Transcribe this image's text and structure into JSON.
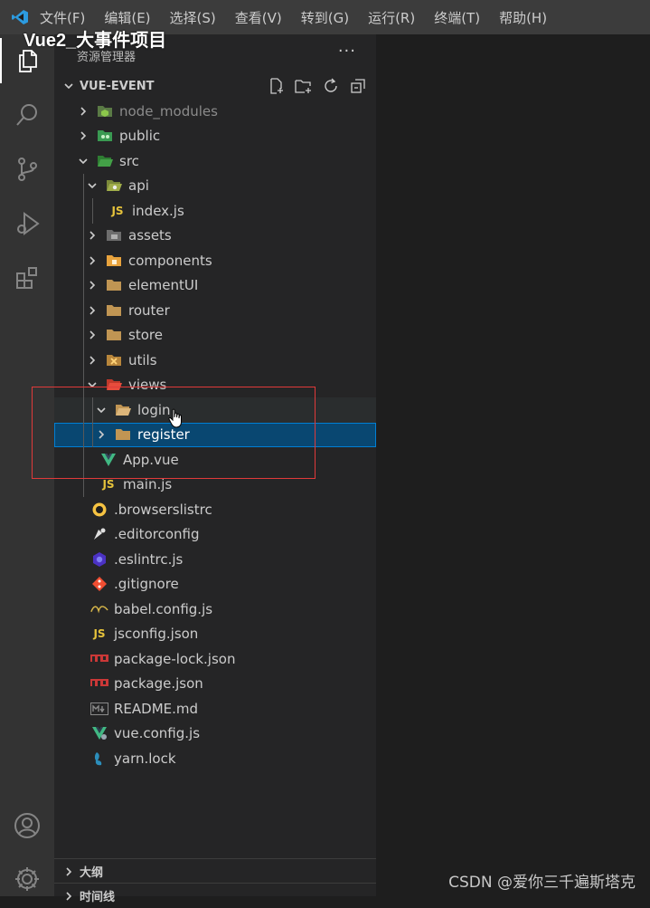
{
  "overlay_title": "Vue2_大事件项目",
  "menu": [
    "文件(F)",
    "编辑(E)",
    "选择(S)",
    "查看(V)",
    "转到(G)",
    "运行(R)",
    "终端(T)",
    "帮助(H)"
  ],
  "sidebar": {
    "title": "资源管理器",
    "more": "···",
    "project": "VUE-EVENT"
  },
  "tree": [
    {
      "label": "node_modules",
      "depth": 0,
      "kind": "folder",
      "expanded": false,
      "icon": "node-modules-icon",
      "dim": true
    },
    {
      "label": "public",
      "depth": 0,
      "kind": "folder",
      "expanded": false,
      "icon": "public-folder-icon"
    },
    {
      "label": "src",
      "depth": 0,
      "kind": "folder",
      "expanded": true,
      "icon": "src-folder-icon"
    },
    {
      "label": "api",
      "depth": 1,
      "kind": "folder",
      "expanded": true,
      "icon": "api-folder-icon"
    },
    {
      "label": "index.js",
      "depth": 2,
      "kind": "file",
      "icon": "js-icon"
    },
    {
      "label": "assets",
      "depth": 1,
      "kind": "folder",
      "expanded": false,
      "icon": "assets-folder-icon"
    },
    {
      "label": "components",
      "depth": 1,
      "kind": "folder",
      "expanded": false,
      "icon": "components-folder-icon"
    },
    {
      "label": "elementUI",
      "depth": 1,
      "kind": "folder",
      "expanded": false,
      "icon": "folder-icon"
    },
    {
      "label": "router",
      "depth": 1,
      "kind": "folder",
      "expanded": false,
      "icon": "folder-icon"
    },
    {
      "label": "store",
      "depth": 1,
      "kind": "folder",
      "expanded": false,
      "icon": "folder-icon"
    },
    {
      "label": "utils",
      "depth": 1,
      "kind": "folder",
      "expanded": false,
      "icon": "utils-folder-icon"
    },
    {
      "label": "views",
      "depth": 1,
      "kind": "folder",
      "expanded": true,
      "icon": "views-folder-icon"
    },
    {
      "label": "login",
      "depth": 2,
      "kind": "folder",
      "expanded": true,
      "icon": "open-folder-icon",
      "hover": true
    },
    {
      "label": "register",
      "depth": 2,
      "kind": "folder",
      "expanded": false,
      "icon": "folder-icon",
      "selected": true
    },
    {
      "label": "App.vue",
      "depth": 1,
      "kind": "file",
      "icon": "vue-icon"
    },
    {
      "label": "main.js",
      "depth": 1,
      "kind": "file",
      "icon": "js-icon"
    },
    {
      "label": ".browserslistrc",
      "depth": 0,
      "kind": "file",
      "icon": "browserslist-icon"
    },
    {
      "label": ".editorconfig",
      "depth": 0,
      "kind": "file",
      "icon": "editorconfig-icon"
    },
    {
      "label": ".eslintrc.js",
      "depth": 0,
      "kind": "file",
      "icon": "eslint-icon"
    },
    {
      "label": ".gitignore",
      "depth": 0,
      "kind": "file",
      "icon": "git-icon"
    },
    {
      "label": "babel.config.js",
      "depth": 0,
      "kind": "file",
      "icon": "babel-icon"
    },
    {
      "label": "jsconfig.json",
      "depth": 0,
      "kind": "file",
      "icon": "jsconfig-icon"
    },
    {
      "label": "package-lock.json",
      "depth": 0,
      "kind": "file",
      "icon": "npm-icon"
    },
    {
      "label": "package.json",
      "depth": 0,
      "kind": "file",
      "icon": "npm-icon"
    },
    {
      "label": "README.md",
      "depth": 0,
      "kind": "file",
      "icon": "markdown-icon"
    },
    {
      "label": "vue.config.js",
      "depth": 0,
      "kind": "file",
      "icon": "vue-config-icon"
    },
    {
      "label": "yarn.lock",
      "depth": 0,
      "kind": "file",
      "icon": "yarn-icon"
    }
  ],
  "bottom_panels": [
    "大纲",
    "时间线"
  ],
  "watermark": "CSDN @爱你三千遍斯塔克",
  "colors": {
    "accent_selected": "#094771",
    "highlight_box": "#e03a3a",
    "folder": "#dcb67a"
  }
}
